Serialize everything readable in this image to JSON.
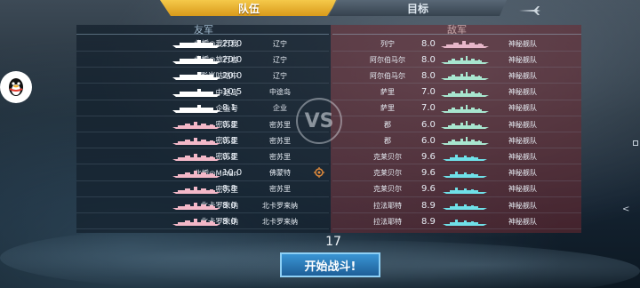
{
  "tabs": {
    "active": "队伍",
    "inactive": "目标"
  },
  "friendly": {
    "header": "友军",
    "rows": [
      {
        "name": "北栀◎我行我",
        "tier": "20.0",
        "cls": "辽宁",
        "ship": "carrier",
        "color": "#ffffff"
      },
      {
        "name": "北栀◎旅行者",
        "tier": "20.0",
        "cls": "辽宁",
        "ship": "carrier",
        "color": "#ffffff"
      },
      {
        "name": "影岚咕咕中",
        "tier": "20.0",
        "cls": "辽宁",
        "ship": "carrier",
        "color": "#ffffff"
      },
      {
        "name": "中途岛",
        "tier": "10.5",
        "cls": "中途岛",
        "ship": "carrier",
        "color": "#ffffff"
      },
      {
        "name": "企业号",
        "tier": "8.1",
        "cls": "企业",
        "ship": "carrier",
        "color": "#ffffff"
      },
      {
        "name": "密苏里",
        "tier": "8.8",
        "cls": "密苏里",
        "ship": "battleship",
        "color": "#f3b8c8"
      },
      {
        "name": "密苏里",
        "tier": "8.8",
        "cls": "密苏里",
        "ship": "battleship",
        "color": "#f3b8c8"
      },
      {
        "name": "密苏里",
        "tier": "8.8",
        "cls": "密苏里",
        "ship": "battleship",
        "color": "#f3b8c8"
      },
      {
        "name": "北栀◎MrYan",
        "tier": "10.0",
        "cls": "佛蒙特",
        "ship": "battleship",
        "color": "#f3b8c8"
      },
      {
        "name": "密苏里",
        "tier": "8.8",
        "cls": "密苏里",
        "ship": "battleship",
        "color": "#f3b8c8"
      },
      {
        "name": "北卡罗来纳",
        "tier": "8.0",
        "cls": "北卡罗来纳",
        "ship": "battleship",
        "color": "#f3b8c8"
      },
      {
        "name": "北卡罗来纳",
        "tier": "8.0",
        "cls": "北卡罗来纳",
        "ship": "battleship",
        "color": "#f3b8c8"
      }
    ]
  },
  "enemy": {
    "header": "敌军",
    "rows": [
      {
        "cls": "列宁",
        "tier": "8.0",
        "name": "神秘舰队",
        "ship": "battleship",
        "color": "#e7b7c9"
      },
      {
        "cls": "阿尔伯马尔",
        "tier": "8.0",
        "name": "神秘舰队",
        "ship": "cruiser",
        "color": "#a8e6cf"
      },
      {
        "cls": "阿尔伯马尔",
        "tier": "8.0",
        "name": "神秘舰队",
        "ship": "cruiser",
        "color": "#a8e6cf"
      },
      {
        "cls": "萨里",
        "tier": "7.0",
        "name": "神秘舰队",
        "ship": "cruiser",
        "color": "#a8e6cf"
      },
      {
        "cls": "萨里",
        "tier": "7.0",
        "name": "神秘舰队",
        "ship": "cruiser",
        "color": "#a8e6cf"
      },
      {
        "cls": "郡",
        "tier": "6.0",
        "name": "神秘舰队",
        "ship": "cruiser",
        "color": "#a8e6cf"
      },
      {
        "cls": "郡",
        "tier": "6.0",
        "name": "神秘舰队",
        "ship": "cruiser",
        "color": "#a8e6cf"
      },
      {
        "cls": "克莱贝尔",
        "tier": "9.6",
        "name": "神秘舰队",
        "ship": "destroyer",
        "color": "#6fe0e8"
      },
      {
        "cls": "克莱贝尔",
        "tier": "9.6",
        "name": "神秘舰队",
        "ship": "destroyer",
        "color": "#6fe0e8"
      },
      {
        "cls": "克莱贝尔",
        "tier": "9.6",
        "name": "神秘舰队",
        "ship": "destroyer",
        "color": "#6fe0e8"
      },
      {
        "cls": "拉法耶特",
        "tier": "8.9",
        "name": "神秘舰队",
        "ship": "destroyer",
        "color": "#6fe0e8"
      },
      {
        "cls": "拉法耶特",
        "tier": "8.9",
        "name": "神秘舰队",
        "ship": "destroyer",
        "color": "#6fe0e8"
      }
    ]
  },
  "vs_label": "VS",
  "countdown": "17",
  "start_button": "开始战斗!"
}
